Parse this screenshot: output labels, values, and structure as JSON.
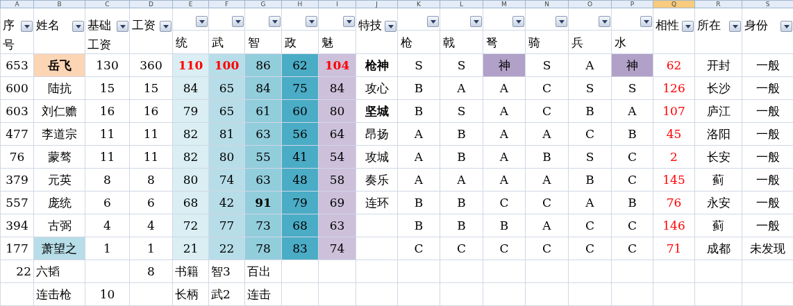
{
  "column_letters": [
    {
      "letter": "A",
      "selected": false
    },
    {
      "letter": "B",
      "selected": false
    },
    {
      "letter": "C",
      "selected": false
    },
    {
      "letter": "D",
      "selected": false
    },
    {
      "letter": "E",
      "selected": false
    },
    {
      "letter": "F",
      "selected": false
    },
    {
      "letter": "G",
      "selected": false
    },
    {
      "letter": "H",
      "selected": false
    },
    {
      "letter": "I",
      "selected": false
    },
    {
      "letter": "J",
      "selected": false
    },
    {
      "letter": "K",
      "selected": false
    },
    {
      "letter": "L",
      "selected": false
    },
    {
      "letter": "M",
      "selected": false
    },
    {
      "letter": "N",
      "selected": false
    },
    {
      "letter": "O",
      "selected": false
    },
    {
      "letter": "P",
      "selected": false
    },
    {
      "letter": "Q",
      "selected": true
    },
    {
      "letter": "R",
      "selected": false
    },
    {
      "letter": "S",
      "selected": false
    }
  ],
  "headers": [
    {
      "label": "序号",
      "kind": "full"
    },
    {
      "label": "姓名",
      "kind": "full"
    },
    {
      "label": "基础工资",
      "kind": "full"
    },
    {
      "label": "工资",
      "kind": "full"
    },
    {
      "label": "统",
      "kind": "split",
      "color": "#daeef3"
    },
    {
      "label": "武",
      "kind": "split",
      "color": "#b7dde8"
    },
    {
      "label": "智",
      "kind": "split",
      "color": "#92cddc"
    },
    {
      "label": "政",
      "kind": "split",
      "color": "#4bacc6"
    },
    {
      "label": "魅",
      "kind": "split",
      "color": "#ccc0da"
    },
    {
      "label": "特技",
      "kind": "full"
    },
    {
      "label": "枪",
      "kind": "split"
    },
    {
      "label": "戟",
      "kind": "split"
    },
    {
      "label": "弩",
      "kind": "split"
    },
    {
      "label": "骑",
      "kind": "split"
    },
    {
      "label": "兵",
      "kind": "split"
    },
    {
      "label": "水",
      "kind": "split"
    },
    {
      "label": "相性",
      "kind": "full",
      "red": true
    },
    {
      "label": "所在",
      "kind": "full"
    },
    {
      "label": "身份",
      "kind": "full"
    }
  ],
  "rows": [
    {
      "kind": "data",
      "cells": [
        "653",
        {
          "text": "岳飞",
          "bold": true,
          "color": "#fcd5b4"
        },
        "130",
        "360",
        {
          "text": "110",
          "bold": true,
          "red": true
        },
        {
          "text": "100",
          "bold": true,
          "red": true
        },
        "86",
        "62",
        {
          "text": "104",
          "bold": true,
          "red": true
        },
        {
          "text": "枪神",
          "bold": true
        },
        "S",
        "S",
        {
          "text": "神",
          "color": "#b1a0c7"
        },
        "S",
        "A",
        {
          "text": "神",
          "color": "#b1a0c7"
        },
        "62",
        "开封",
        "一般"
      ]
    },
    {
      "kind": "data",
      "cells": [
        "600",
        "陆抗",
        "15",
        "15",
        "84",
        "65",
        "84",
        "75",
        "84",
        "攻心",
        "B",
        "A",
        "A",
        "C",
        "S",
        "S",
        "126",
        "长沙",
        "一般"
      ]
    },
    {
      "kind": "data",
      "cells": [
        "603",
        "刘仁赡",
        "16",
        "16",
        "79",
        "65",
        "61",
        "60",
        "80",
        {
          "text": "坚城",
          "bold": true
        },
        "B",
        "S",
        "A",
        "C",
        "B",
        "A",
        "107",
        "庐江",
        "一般"
      ]
    },
    {
      "kind": "data",
      "cells": [
        "477",
        "李道宗",
        "11",
        "11",
        "82",
        "81",
        "63",
        "56",
        "64",
        "昂扬",
        "A",
        "B",
        "A",
        "A",
        "C",
        "B",
        "45",
        "洛阳",
        "一般"
      ]
    },
    {
      "kind": "data",
      "cells": [
        "76",
        "蒙骜",
        "11",
        "11",
        "82",
        "80",
        "55",
        "41",
        "54",
        "攻城",
        "A",
        "B",
        "A",
        "B",
        "S",
        "C",
        "2",
        "长安",
        "一般"
      ]
    },
    {
      "kind": "data",
      "cells": [
        "379",
        "元英",
        "8",
        "8",
        "80",
        "74",
        "63",
        "48",
        "58",
        "奏乐",
        "A",
        "A",
        "A",
        "A",
        "B",
        "C",
        "145",
        "蓟",
        "一般"
      ]
    },
    {
      "kind": "data",
      "cells": [
        "557",
        "庞统",
        "6",
        "6",
        "68",
        "42",
        {
          "text": "91",
          "bold": true
        },
        "79",
        "69",
        "连环",
        "B",
        "B",
        "C",
        "C",
        "A",
        "B",
        "76",
        "永安",
        "一般"
      ]
    },
    {
      "kind": "data",
      "cells": [
        "394",
        "古弼",
        "4",
        "4",
        "72",
        "77",
        "73",
        "68",
        "63",
        "",
        "B",
        "B",
        "B",
        "A",
        "C",
        "C",
        "146",
        "蓟",
        "一般"
      ]
    },
    {
      "kind": "data",
      "cells": [
        "177",
        {
          "text": "萧望之",
          "color": "#b7dde8"
        },
        "1",
        "1",
        "21",
        "22",
        "78",
        "83",
        "74",
        "",
        "C",
        "C",
        "C",
        "C",
        "C",
        "C",
        "71",
        "成都",
        "未发现"
      ]
    },
    {
      "kind": "extra",
      "cells": [
        "22",
        "六韬",
        "",
        "8",
        "书籍",
        "智3",
        "百出"
      ]
    },
    {
      "kind": "extra",
      "cells": [
        "",
        "连击枪",
        "10",
        "",
        "长柄",
        "武2",
        "连击"
      ]
    }
  ]
}
